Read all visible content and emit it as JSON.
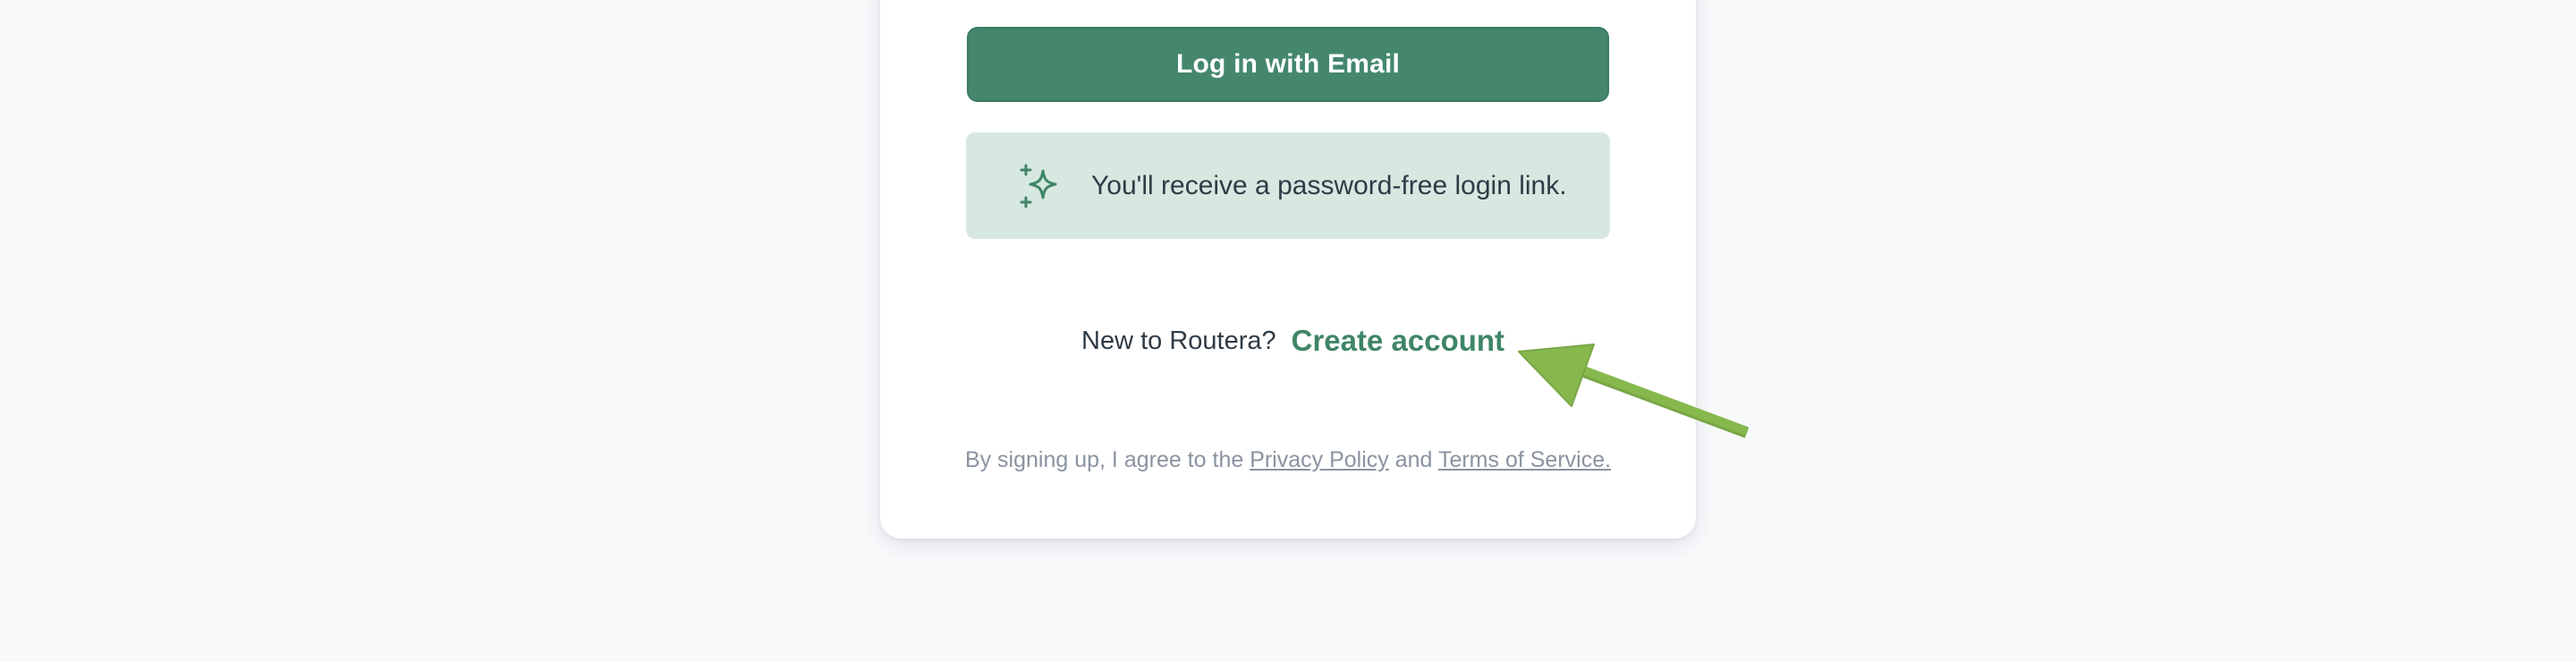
{
  "login": {
    "email_button_label": "Log in with Email"
  },
  "info": {
    "icon": "sparkles-icon",
    "text": "You'll receive a password-free login link."
  },
  "signup": {
    "prompt": "New to Routera?",
    "link_label": "Create account"
  },
  "terms": {
    "prefix": "By signing up, I agree to the ",
    "privacy_label": "Privacy Policy",
    "conjunction": " and ",
    "tos_label": "Terms of Service."
  },
  "colors": {
    "accent": "#44876d",
    "info_bg": "#d7e8e1",
    "page_bg": "#f8f9fb",
    "annotation_arrow": "#86b84e"
  }
}
